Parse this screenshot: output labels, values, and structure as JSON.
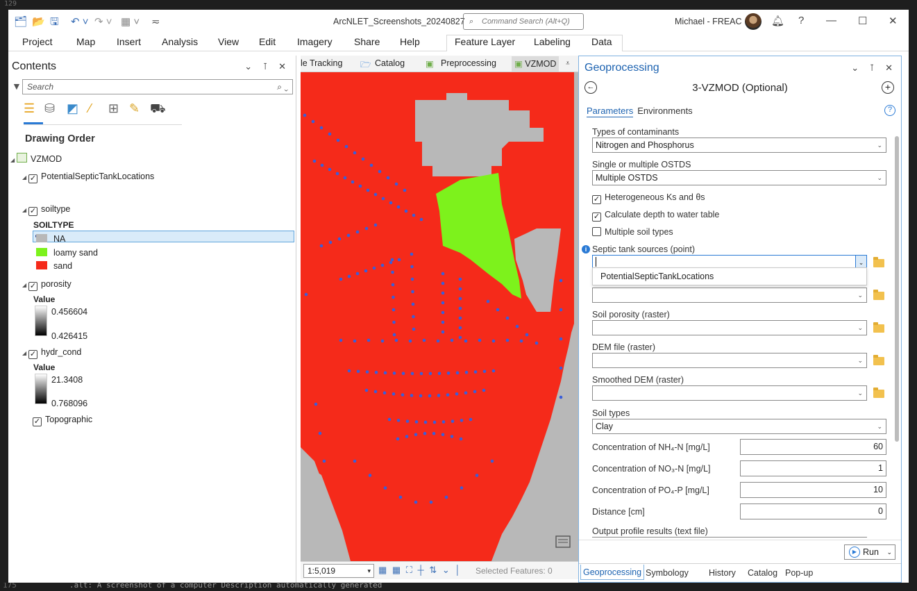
{
  "editor": {
    "top_line_number": "129",
    "bottom_line_number": "175",
    "bottom_text": ".alt: A screenshot of a computer Description automatically generated"
  },
  "titlebar": {
    "title": "ArcNLET_Screenshots_20240827",
    "command_search_placeholder": "Command Search (Alt+Q)",
    "user": "Michael - FREAC",
    "help": "?",
    "minimize": "—",
    "maximize": "☐",
    "close": "✕"
  },
  "ribbon": {
    "tabs": [
      "Project",
      "Map",
      "Insert",
      "Analysis",
      "View",
      "Edit",
      "Imagery",
      "Share",
      "Help",
      "Feature Layer",
      "Labeling",
      "Data"
    ]
  },
  "contents": {
    "title": "Contents",
    "search_placeholder": "Search",
    "drawing_order": "Drawing Order",
    "map_name": "VZMOD",
    "layers": {
      "septic": "PotentialSepticTankLocations",
      "soiltype": "soiltype",
      "soiltype_field": "SOILTYPE",
      "soil_classes": [
        {
          "label": "NA",
          "color": "#b8b8b8"
        },
        {
          "label": "loamy sand",
          "color": "#7df21c"
        },
        {
          "label": "sand",
          "color": "#f52a1a"
        }
      ],
      "porosity": "porosity",
      "porosity_value_label": "Value",
      "porosity_max": "0.456604",
      "porosity_min": "0.426415",
      "hydr_cond": "hydr_cond",
      "hydr_value_label": "Value",
      "hydr_max": "21.3408",
      "hydr_min": "0.768096",
      "topographic": "Topographic"
    }
  },
  "mapview": {
    "tabs": [
      "le Tracking",
      "Catalog",
      "Preprocessing",
      "VZMOD"
    ],
    "scale": "1:5,019",
    "selected_features": "Selected Features: 0",
    "colors": {
      "sand": "#f52a1a",
      "loamy_sand": "#7df21c",
      "na": "#b8b8b8",
      "points": "#3b5ed8"
    }
  },
  "geoprocessing": {
    "title": "Geoprocessing",
    "tool_name": "3-VZMOD (Optional)",
    "tab_parameters": "Parameters",
    "tab_environments": "Environments",
    "contaminants_label": "Types of contaminants",
    "contaminants_value": "Nitrogen and Phosphorus",
    "ostds_label": "Single or multiple OSTDS",
    "ostds_value": "Multiple OSTDS",
    "check_heterogeneous": "Heterogeneous Ks and θs",
    "check_depth": "Calculate depth to water table",
    "check_multiple_soil": "Multiple soil types",
    "septic_label": "Septic tank sources (point)",
    "septic_popup_option": "PotentialSepticTankLocations",
    "porosity_label": "Soil porosity (raster)",
    "dem_label": "DEM file (raster)",
    "smoothed_dem_label": "Smoothed DEM (raster)",
    "soil_types_label": "Soil types",
    "soil_types_value": "Clay",
    "nh4_label": "Concentration of NH₄-N [mg/L]",
    "nh4_value": "60",
    "no3_label": "Concentration of NO₃-N [mg/L]",
    "no3_value": "1",
    "po4_label": "Concentration of PO₄-P [mg/L]",
    "po4_value": "10",
    "distance_label": "Distance [cm]",
    "distance_value": "0",
    "output_label": "Output profile results (text file)",
    "run_label": "Run",
    "bottom_tabs": [
      "Geoprocessing",
      "Symbology",
      "History",
      "Catalog",
      "Pop-up"
    ]
  }
}
